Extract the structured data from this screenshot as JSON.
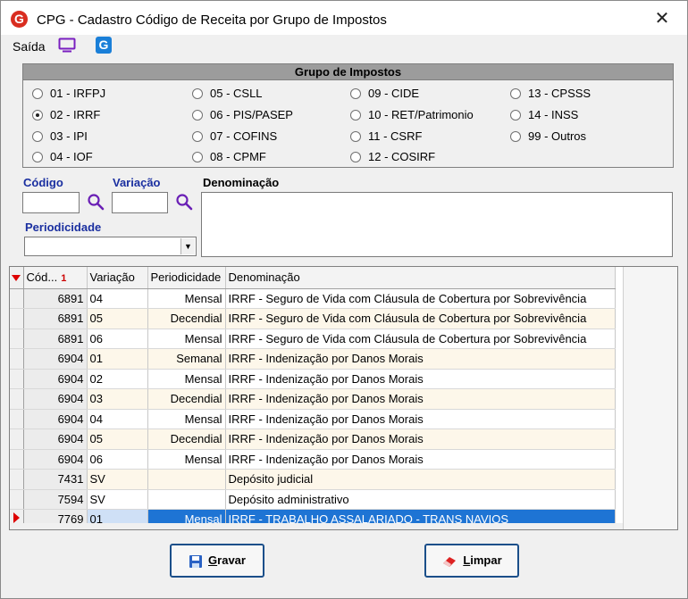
{
  "window": {
    "title": "CPG - Cadastro Código de Receita por Grupo de Impostos",
    "close_glyph": "✕",
    "logo_letter": "G"
  },
  "toolbar": {
    "saida_label": "Saída",
    "icons": [
      "monitor-icon",
      "g-logo-icon"
    ],
    "g_letter": "G"
  },
  "group": {
    "title": "Grupo de Impostos",
    "options": [
      {
        "label": "01 - IRFPJ",
        "checked": false
      },
      {
        "label": "02 - IRRF",
        "checked": true
      },
      {
        "label": "03 - IPI",
        "checked": false
      },
      {
        "label": "04 - IOF",
        "checked": false
      },
      {
        "label": "05 - CSLL",
        "checked": false
      },
      {
        "label": "06 - PIS/PASEP",
        "checked": false
      },
      {
        "label": "07 - COFINS",
        "checked": false
      },
      {
        "label": "08 - CPMF",
        "checked": false
      },
      {
        "label": "09 - CIDE",
        "checked": false
      },
      {
        "label": "10 - RET/Patrimonio",
        "checked": false
      },
      {
        "label": "11 - CSRF",
        "checked": false
      },
      {
        "label": "12 - COSIRF",
        "checked": false
      },
      {
        "label": "13 - CPSSS",
        "checked": false
      },
      {
        "label": "14 - INSS",
        "checked": false
      },
      {
        "label": "99 - Outros",
        "checked": false
      }
    ]
  },
  "filters": {
    "codigo_label": "Código",
    "codigo_value": "",
    "variacao_label": "Variação",
    "variacao_value": "",
    "denominacao_label": "Denominação",
    "denominacao_value": "",
    "periodicidade_label": "Periodicidade",
    "periodicidade_value": ""
  },
  "grid": {
    "columns": [
      "Cód...",
      "Variação",
      "Periodicidade",
      "Denominação"
    ],
    "sort_mark": "1",
    "rows": [
      {
        "codigo": "6891",
        "variacao": "04",
        "periodicidade": "Mensal",
        "denominacao": "IRRF - Seguro de Vida com Cláusula de Cobertura por Sobrevivência"
      },
      {
        "codigo": "6891",
        "variacao": "05",
        "periodicidade": "Decendial",
        "denominacao": "IRRF - Seguro de Vida com Cláusula de Cobertura por Sobrevivência"
      },
      {
        "codigo": "6891",
        "variacao": "06",
        "periodicidade": "Mensal",
        "denominacao": "IRRF - Seguro de Vida com Cláusula de Cobertura por Sobrevivência"
      },
      {
        "codigo": "6904",
        "variacao": "01",
        "periodicidade": "Semanal",
        "denominacao": "IRRF - Indenização por Danos Morais"
      },
      {
        "codigo": "6904",
        "variacao": "02",
        "periodicidade": "Mensal",
        "denominacao": "IRRF - Indenização por Danos Morais"
      },
      {
        "codigo": "6904",
        "variacao": "03",
        "periodicidade": "Decendial",
        "denominacao": "IRRF - Indenização por Danos Morais"
      },
      {
        "codigo": "6904",
        "variacao": "04",
        "periodicidade": "Mensal",
        "denominacao": "IRRF - Indenização por Danos Morais"
      },
      {
        "codigo": "6904",
        "variacao": "05",
        "periodicidade": "Decendial",
        "denominacao": "IRRF - Indenização por Danos Morais"
      },
      {
        "codigo": "6904",
        "variacao": "06",
        "periodicidade": "Mensal",
        "denominacao": "IRRF - Indenização por Danos Morais"
      },
      {
        "codigo": "7431",
        "variacao": "SV",
        "periodicidade": "",
        "denominacao": "Depósito judicial"
      },
      {
        "codigo": "7594",
        "variacao": "SV",
        "periodicidade": "",
        "denominacao": "Depósito administrativo"
      },
      {
        "codigo": "7769",
        "variacao": "01",
        "periodicidade": "Mensal",
        "denominacao": "IRRF - TRABALHO ASSALARIADO - TRANS NAVIOS",
        "selected": true
      }
    ]
  },
  "buttons": {
    "gravar_first": "G",
    "gravar_rest": "ravar",
    "limpar_first": "L",
    "limpar_rest": "impar"
  },
  "colors": {
    "selection": "#1e74d4",
    "label_blue": "#1a2fa0",
    "search_icon": "#6a1fb5",
    "alt_row": "#fdf7ea"
  }
}
